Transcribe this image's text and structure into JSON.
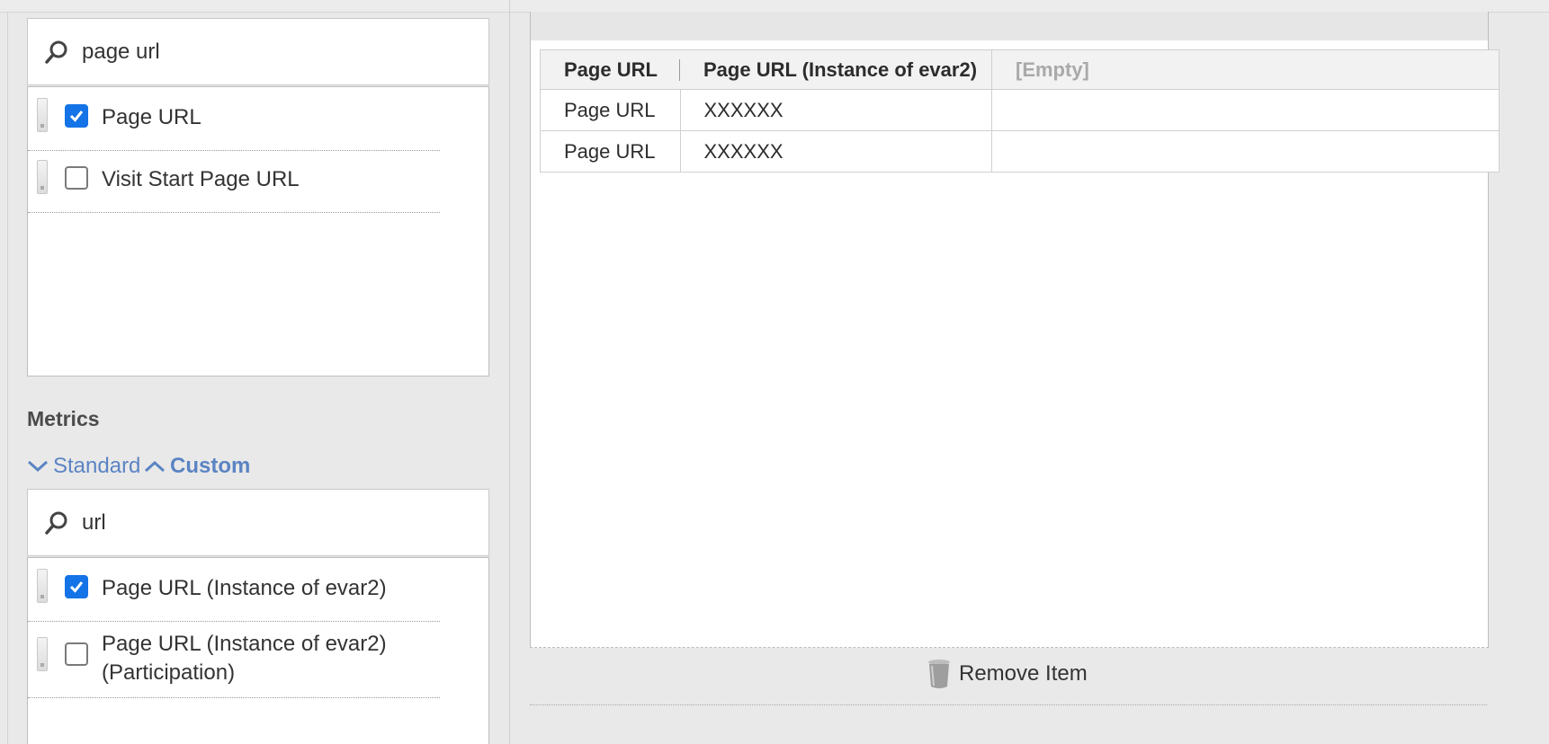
{
  "dimensions_search": {
    "icon": "search-icon",
    "value": "page url"
  },
  "dimensions_list": [
    {
      "label": "Page URL",
      "checked": true
    },
    {
      "label": "Visit Start Page URL",
      "checked": false
    }
  ],
  "metrics": {
    "title": "Metrics",
    "standard_label": "Standard",
    "custom_label": "Custom",
    "search_value": "url",
    "items": [
      {
        "label": "Page URL (Instance of evar2)",
        "checked": true
      },
      {
        "label_line1": "Page URL (Instance of evar2)",
        "label_line2": "(Participation)",
        "checked": false
      }
    ]
  },
  "table": {
    "headers": [
      "Page URL",
      "Page URL (Instance of evar2)",
      "[Empty]"
    ],
    "rows": [
      [
        "Page URL",
        "XXXXXX",
        ""
      ],
      [
        "Page URL",
        "XXXXXX",
        ""
      ]
    ]
  },
  "remove_item": {
    "label": "Remove Item",
    "icon": "trash-icon"
  },
  "colors": {
    "accent": "#1473e6",
    "link": "#5b84c4"
  }
}
